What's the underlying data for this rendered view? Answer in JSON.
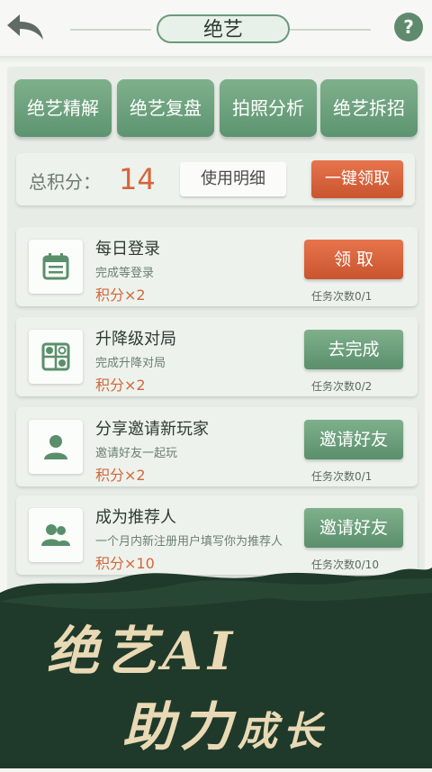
{
  "header": {
    "title": "绝艺"
  },
  "tabs": [
    {
      "label": "绝艺精解"
    },
    {
      "label": "绝艺复盘"
    },
    {
      "label": "拍照分析"
    },
    {
      "label": "绝艺拆招"
    }
  ],
  "score": {
    "label": "总积分：",
    "value": "14",
    "detail_label": "使用明细",
    "claim_all_label": "一键领取"
  },
  "tasks": [
    {
      "title": "每日登录",
      "desc": "完成等登录",
      "points": "积分×2",
      "button": "领 取",
      "count": "任务次数0/1",
      "icon": "calendar-icon"
    },
    {
      "title": "升降级对局",
      "desc": "完成升降对局",
      "points": "积分×2",
      "button": "去完成",
      "count": "任务次数0/2",
      "icon": "go-board-icon"
    },
    {
      "title": "分享邀请新玩家",
      "desc": "邀请好友一起玩",
      "points": "积分×2",
      "button": "邀请好友",
      "count": "任务次数0/1",
      "icon": "user-icon"
    },
    {
      "title": "成为推荐人",
      "desc": "一个月内新注册用户填写你为推荐人",
      "points": "积分×10",
      "button": "邀请好友",
      "count": "任务次数0/10",
      "icon": "users-icon"
    }
  ],
  "banner": {
    "line1": "绝艺AI",
    "line2_main": "助力",
    "line2_small": "成长"
  },
  "colors": {
    "accent_green": "#6a9a7a",
    "accent_orange": "#d7643a",
    "banner_dark": "#1f3a2a"
  }
}
